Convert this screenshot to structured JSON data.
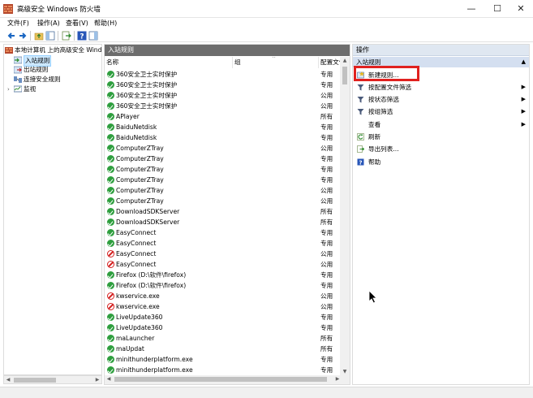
{
  "window": {
    "title": "高级安全 Windows 防火墙",
    "controls": {
      "minimize": "—",
      "maximize": "☐",
      "close": "✕"
    }
  },
  "menu": [
    "文件(F)",
    "操作(A)",
    "查看(V)",
    "帮助(H)"
  ],
  "toolbar": {
    "icons": [
      "back-arrow-icon",
      "forward-arrow-icon",
      "folder-up-icon",
      "show-tree-icon",
      "export-icon",
      "help-icon",
      "show-action-pane-icon"
    ]
  },
  "tree": {
    "root": "本地计算机 上的高级安全 Windo",
    "items": [
      {
        "label": "入站规则",
        "icon": "inbound-rules-icon",
        "selected": true
      },
      {
        "label": "出站规则",
        "icon": "outbound-rules-icon",
        "selected": false
      },
      {
        "label": "连接安全规则",
        "icon": "connection-security-icon",
        "selected": false
      },
      {
        "label": "监视",
        "icon": "monitor-icon",
        "selected": false
      }
    ]
  },
  "center": {
    "title": "入站规则",
    "columns": [
      "名称",
      "组",
      "配置文件"
    ],
    "rows": [
      {
        "name": "360安全卫士实时保护",
        "status": "allow",
        "profile": "专用"
      },
      {
        "name": "360安全卫士实时保护",
        "status": "allow",
        "profile": "专用"
      },
      {
        "name": "360安全卫士实时保护",
        "status": "allow",
        "profile": "公用"
      },
      {
        "name": "360安全卫士实时保护",
        "status": "allow",
        "profile": "公用"
      },
      {
        "name": "APlayer",
        "status": "allow",
        "profile": "所有"
      },
      {
        "name": "BaiduNetdisk",
        "status": "allow",
        "profile": "专用"
      },
      {
        "name": "BaiduNetdisk",
        "status": "allow",
        "profile": "专用"
      },
      {
        "name": "ComputerZTray",
        "status": "allow",
        "profile": "公用"
      },
      {
        "name": "ComputerZTray",
        "status": "allow",
        "profile": "专用"
      },
      {
        "name": "ComputerZTray",
        "status": "allow",
        "profile": "专用"
      },
      {
        "name": "ComputerZTray",
        "status": "allow",
        "profile": "专用"
      },
      {
        "name": "ComputerZTray",
        "status": "allow",
        "profile": "公用"
      },
      {
        "name": "ComputerZTray",
        "status": "allow",
        "profile": "公用"
      },
      {
        "name": "DownloadSDKServer",
        "status": "allow",
        "profile": "所有"
      },
      {
        "name": "DownloadSDKServer",
        "status": "allow",
        "profile": "所有"
      },
      {
        "name": "EasyConnect",
        "status": "allow",
        "profile": "专用"
      },
      {
        "name": "EasyConnect",
        "status": "allow",
        "profile": "专用"
      },
      {
        "name": "EasyConnect",
        "status": "block",
        "profile": "公用"
      },
      {
        "name": "EasyConnect",
        "status": "block",
        "profile": "公用"
      },
      {
        "name": "Firefox (D:\\软件\\firefox)",
        "status": "allow",
        "profile": "专用"
      },
      {
        "name": "Firefox (D:\\软件\\firefox)",
        "status": "allow",
        "profile": "专用"
      },
      {
        "name": "kwservice.exe",
        "status": "block",
        "profile": "公用"
      },
      {
        "name": "kwservice.exe",
        "status": "block",
        "profile": "公用"
      },
      {
        "name": "LiveUpdate360",
        "status": "allow",
        "profile": "专用"
      },
      {
        "name": "LiveUpdate360",
        "status": "allow",
        "profile": "专用"
      },
      {
        "name": "maLauncher",
        "status": "allow",
        "profile": "所有"
      },
      {
        "name": "maUpdat",
        "status": "allow",
        "profile": "所有"
      },
      {
        "name": "minithunderplatform.exe",
        "status": "allow",
        "profile": "专用"
      },
      {
        "name": "minithunderplatform.exe",
        "status": "allow",
        "profile": "专用"
      }
    ]
  },
  "actions": {
    "title": "操作",
    "section": "入站规则",
    "items": [
      {
        "label": "新建规则...",
        "icon": "new-rule-icon",
        "submenu": false
      },
      {
        "label": "按配置文件筛选",
        "icon": "filter-icon",
        "submenu": true
      },
      {
        "label": "按状态筛选",
        "icon": "filter-icon",
        "submenu": true
      },
      {
        "label": "按组筛选",
        "icon": "filter-icon",
        "submenu": true
      },
      {
        "label": "查看",
        "icon": "",
        "submenu": true
      },
      {
        "label": "刷新",
        "icon": "refresh-icon",
        "submenu": false
      },
      {
        "label": "导出列表...",
        "icon": "export-list-icon",
        "submenu": false
      },
      {
        "label": "帮助",
        "icon": "help-icon",
        "submenu": false
      }
    ]
  },
  "colors": {
    "panel_header": "#6d6d6d",
    "action_section": "#d4dff0",
    "allow_green": "#2e9e3e",
    "block_red": "#d42020",
    "highlight": "#e0211f"
  }
}
